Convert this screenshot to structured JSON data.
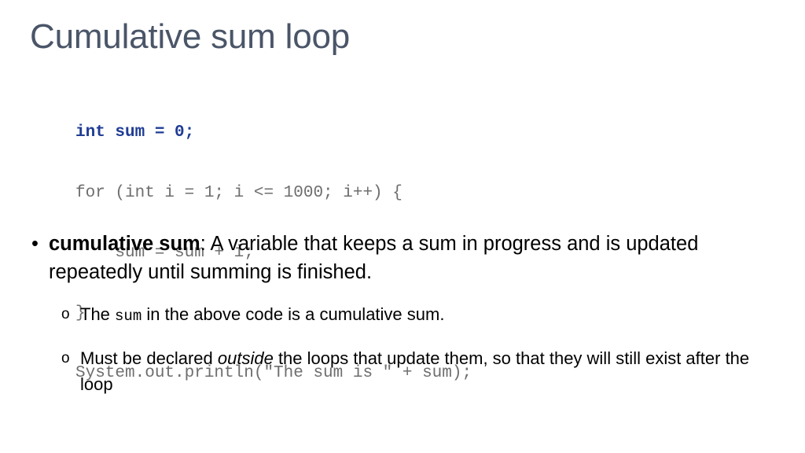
{
  "slide": {
    "title": "Cumulative sum loop",
    "title_color": "#4A5568",
    "background_color": "#ffffff"
  },
  "code_block": {
    "highlight_color": "#1F3C94",
    "plain_color": "#6E6E6E",
    "lines": [
      {
        "text": "int sum = 0;",
        "highlighted": true
      },
      {
        "text": "for (int i = 1; i <= 1000; i++) {",
        "highlighted": false
      },
      {
        "text": "    sum = sum + i;",
        "highlighted": false
      },
      {
        "text": "}",
        "highlighted": false
      },
      {
        "text": "System.out.println(\"The sum is \" + sum);",
        "highlighted": false
      }
    ]
  },
  "bullets": {
    "level1": {
      "marker": "bullet-dot",
      "marker_glyph": "•",
      "term": "cumulative sum",
      "definition": ": A variable that keeps a sum in progress and is updated repeatedly until summing is finished."
    },
    "level2": [
      {
        "marker": "hollow-circle",
        "marker_glyph": "o",
        "parts": [
          {
            "text": "The ",
            "style": "normal"
          },
          {
            "text": "sum",
            "style": "mono"
          },
          {
            "text": " in the above code is a cumulative sum.",
            "style": "normal"
          }
        ]
      },
      {
        "marker": "hollow-circle",
        "marker_glyph": "o",
        "parts": [
          {
            "text": "Must be declared ",
            "style": "normal"
          },
          {
            "text": "outside",
            "style": "italic"
          },
          {
            "text": " the loops that update them, so that they will still exist after the loop",
            "style": "normal"
          }
        ]
      }
    ]
  }
}
